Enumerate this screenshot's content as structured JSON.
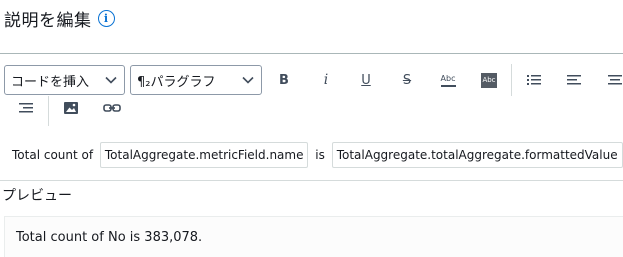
{
  "header": {
    "title": "説明を編集",
    "info_icon": "i"
  },
  "toolbar": {
    "insert_code_label": "コードを挿入",
    "paragraph_label": "¶₂パラグラフ",
    "buttons": {
      "bold": "B",
      "italic": "i",
      "underline": "U",
      "strikethrough": "S",
      "text_color": "Abc",
      "highlight": "Abc"
    }
  },
  "template": {
    "text1": "Total count of ",
    "field1": "TotalAggregate.metricField.name",
    "text2": " is ",
    "field2": "TotalAggregate.totalAggregate.formattedValue",
    "text3": "."
  },
  "preview": {
    "title": "プレビュー",
    "text": "Total count of No is 383,078."
  },
  "colors": {
    "link": "#0972d3",
    "text": "#16191f",
    "icon": "#414d5c"
  }
}
